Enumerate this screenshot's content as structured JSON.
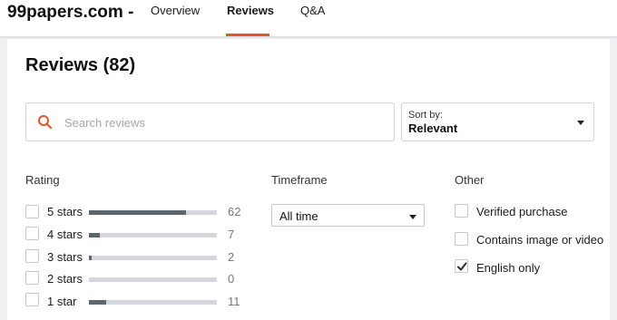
{
  "header": {
    "brand": "99papers.com -",
    "tabs": [
      {
        "label": "Overview",
        "active": false
      },
      {
        "label": "Reviews",
        "active": true
      },
      {
        "label": "Q&A",
        "active": false
      }
    ]
  },
  "main": {
    "heading": "Reviews (82)",
    "search": {
      "placeholder": "Search reviews",
      "value": "",
      "icon": "search-icon"
    },
    "sort": {
      "label": "Sort by:",
      "value": "Relevant"
    }
  },
  "filters": {
    "rating": {
      "title": "Rating",
      "items": [
        {
          "label": "5 stars",
          "count": "62",
          "share": 0.756,
          "checked": false
        },
        {
          "label": "4 stars",
          "count": "7",
          "share": 0.085,
          "checked": false
        },
        {
          "label": "3 stars",
          "count": "2",
          "share": 0.024,
          "checked": false
        },
        {
          "label": "2 stars",
          "count": "0",
          "share": 0,
          "checked": false
        },
        {
          "label": "1 star",
          "count": "11",
          "share": 0.134,
          "checked": false
        }
      ]
    },
    "timeframe": {
      "title": "Timeframe",
      "value": "All time"
    },
    "other": {
      "title": "Other",
      "items": [
        {
          "label": "Verified purchase",
          "checked": false
        },
        {
          "label": "Contains image or video",
          "checked": false
        },
        {
          "label": "English only",
          "checked": true
        }
      ]
    }
  },
  "colors": {
    "accent": "#e8542a",
    "bar_fill": "#5b6670",
    "bar_track": "#d3d7db"
  }
}
